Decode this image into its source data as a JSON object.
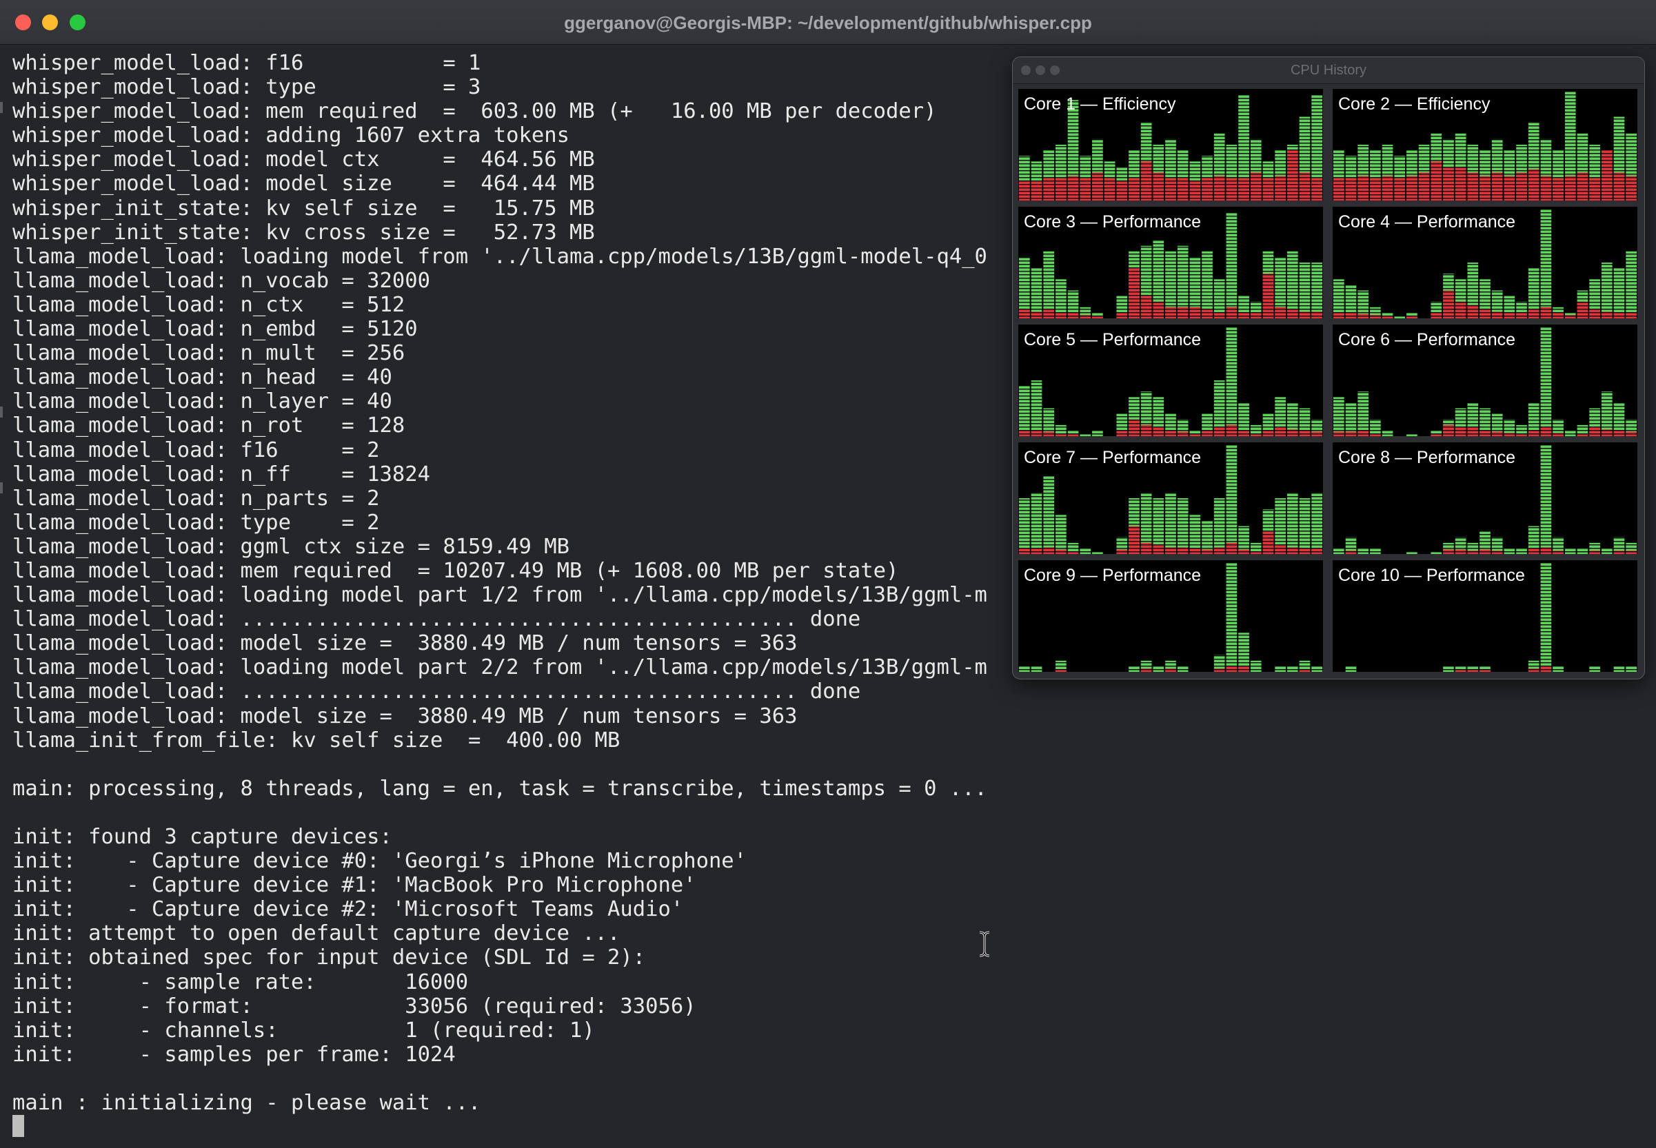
{
  "window": {
    "title": "ggerganov@Georgis-MBP: ~/development/github/whisper.cpp"
  },
  "terminal": {
    "lines": [
      "whisper_model_load: f16           = 1",
      "whisper_model_load: type          = 3",
      "whisper_model_load: mem required  =  603.00 MB (+   16.00 MB per decoder)",
      "whisper_model_load: adding 1607 extra tokens",
      "whisper_model_load: model ctx     =  464.56 MB",
      "whisper_model_load: model size    =  464.44 MB",
      "whisper_init_state: kv self size  =   15.75 MB",
      "whisper_init_state: kv cross size =   52.73 MB",
      "llama_model_load: loading model from '../llama.cpp/models/13B/ggml-model-q4_0",
      "llama_model_load: n_vocab = 32000",
      "llama_model_load: n_ctx   = 512",
      "llama_model_load: n_embd  = 5120",
      "llama_model_load: n_mult  = 256",
      "llama_model_load: n_head  = 40",
      "llama_model_load: n_layer = 40",
      "llama_model_load: n_rot   = 128",
      "llama_model_load: f16     = 2",
      "llama_model_load: n_ff    = 13824",
      "llama_model_load: n_parts = 2",
      "llama_model_load: type    = 2",
      "llama_model_load: ggml ctx size = 8159.49 MB",
      "llama_model_load: mem required  = 10207.49 MB (+ 1608.00 MB per state)",
      "llama_model_load: loading model part 1/2 from '../llama.cpp/models/13B/ggml-m",
      "llama_model_load: ............................................ done",
      "llama_model_load: model size =  3880.49 MB / num tensors = 363",
      "llama_model_load: loading model part 2/2 from '../llama.cpp/models/13B/ggml-m",
      "llama_model_load: ............................................ done",
      "llama_model_load: model size =  3880.49 MB / num tensors = 363",
      "llama_init_from_file: kv self size  =  400.00 MB",
      "",
      "main: processing, 8 threads, lang = en, task = transcribe, timestamps = 0 ...",
      "",
      "init: found 3 capture devices:",
      "init:    - Capture device #0: 'Georgi’s iPhone Microphone'",
      "init:    - Capture device #1: 'MacBook Pro Microphone'",
      "init:    - Capture device #2: 'Microsoft Teams Audio'",
      "init: attempt to open default capture device ...",
      "init: obtained spec for input device (SDL Id = 2):",
      "init:     - sample rate:       16000",
      "init:     - format:            33056 (required: 33056)",
      "init:     - channels:          1 (required: 1)",
      "init:     - samples per frame: 1024",
      "",
      "main : initializing - please wait ..."
    ]
  },
  "cpu_history": {
    "title": "CPU History",
    "colors": {
      "user": "#5fd35a",
      "system": "#e2333a",
      "background": "#000000"
    },
    "cores": [
      {
        "label": "Core 1 — Efficiency",
        "user": [
          0.4,
          0.35,
          0.45,
          0.5,
          0.9,
          0.4,
          0.55,
          0.35,
          0.3,
          0.45,
          0.7,
          0.5,
          0.55,
          0.45,
          0.35,
          0.4,
          0.6,
          0.5,
          0.95,
          0.55,
          0.35,
          0.45,
          0.5,
          0.75,
          0.95
        ],
        "system": [
          0.18,
          0.17,
          0.2,
          0.2,
          0.22,
          0.2,
          0.25,
          0.2,
          0.18,
          0.2,
          0.35,
          0.25,
          0.2,
          0.2,
          0.18,
          0.2,
          0.22,
          0.2,
          0.2,
          0.25,
          0.2,
          0.22,
          0.45,
          0.25,
          0.2
        ]
      },
      {
        "label": "Core 2 — Efficiency",
        "user": [
          0.45,
          0.4,
          0.5,
          0.45,
          0.5,
          0.4,
          0.45,
          0.5,
          0.6,
          0.55,
          0.6,
          0.5,
          0.45,
          0.55,
          0.45,
          0.5,
          0.7,
          0.55,
          0.45,
          0.98,
          0.6,
          0.5,
          0.45,
          0.75,
          0.6
        ],
        "system": [
          0.2,
          0.2,
          0.22,
          0.2,
          0.22,
          0.2,
          0.22,
          0.25,
          0.35,
          0.3,
          0.3,
          0.25,
          0.22,
          0.25,
          0.22,
          0.25,
          0.28,
          0.22,
          0.2,
          0.22,
          0.25,
          0.2,
          0.45,
          0.25,
          0.22
        ]
      },
      {
        "label": "Core 3 — Performance",
        "user": [
          0.55,
          0.45,
          0.6,
          0.35,
          0.25,
          0.1,
          0.05,
          0.0,
          0.2,
          0.6,
          0.65,
          0.7,
          0.6,
          0.65,
          0.55,
          0.6,
          0.35,
          0.95,
          0.2,
          0.15,
          0.6,
          0.55,
          0.6,
          0.5,
          0.5
        ],
        "system": [
          0.08,
          0.06,
          0.08,
          0.05,
          0.05,
          0.03,
          0.02,
          0.0,
          0.05,
          0.45,
          0.2,
          0.15,
          0.1,
          0.1,
          0.1,
          0.08,
          0.05,
          0.1,
          0.05,
          0.05,
          0.4,
          0.1,
          0.08,
          0.06,
          0.06
        ]
      },
      {
        "label": "Core 4 — Performance",
        "user": [
          0.35,
          0.3,
          0.25,
          0.1,
          0.05,
          0.02,
          0.05,
          0.0,
          0.15,
          0.4,
          0.35,
          0.5,
          0.35,
          0.25,
          0.2,
          0.15,
          0.45,
          0.98,
          0.1,
          0.05,
          0.25,
          0.35,
          0.5,
          0.45,
          0.6
        ],
        "system": [
          0.05,
          0.05,
          0.04,
          0.03,
          0.02,
          0.0,
          0.02,
          0.0,
          0.05,
          0.25,
          0.15,
          0.12,
          0.08,
          0.06,
          0.05,
          0.05,
          0.08,
          0.1,
          0.05,
          0.03,
          0.15,
          0.08,
          0.06,
          0.05,
          0.05
        ]
      },
      {
        "label": "Core 5 — Performance",
        "user": [
          0.45,
          0.5,
          0.25,
          0.1,
          0.05,
          0.02,
          0.05,
          0.0,
          0.2,
          0.35,
          0.4,
          0.35,
          0.2,
          0.15,
          0.05,
          0.2,
          0.5,
          0.98,
          0.3,
          0.1,
          0.2,
          0.35,
          0.3,
          0.25,
          0.15
        ],
        "system": [
          0.05,
          0.05,
          0.04,
          0.02,
          0.02,
          0.0,
          0.0,
          0.0,
          0.05,
          0.15,
          0.1,
          0.08,
          0.05,
          0.04,
          0.02,
          0.05,
          0.08,
          0.1,
          0.05,
          0.02,
          0.05,
          0.08,
          0.06,
          0.05,
          0.04
        ]
      },
      {
        "label": "Core 6 — Performance",
        "user": [
          0.35,
          0.3,
          0.4,
          0.15,
          0.05,
          0.0,
          0.02,
          0.0,
          0.05,
          0.15,
          0.25,
          0.3,
          0.25,
          0.2,
          0.15,
          0.1,
          0.3,
          0.98,
          0.15,
          0.05,
          0.1,
          0.25,
          0.4,
          0.3,
          0.15
        ],
        "system": [
          0.04,
          0.04,
          0.05,
          0.02,
          0.0,
          0.0,
          0.0,
          0.0,
          0.02,
          0.1,
          0.08,
          0.08,
          0.05,
          0.04,
          0.03,
          0.02,
          0.05,
          0.08,
          0.03,
          0.0,
          0.02,
          0.08,
          0.06,
          0.05,
          0.04
        ]
      },
      {
        "label": "Core 7 — Performance",
        "user": [
          0.5,
          0.55,
          0.7,
          0.35,
          0.1,
          0.05,
          0.02,
          0.0,
          0.15,
          0.5,
          0.55,
          0.5,
          0.55,
          0.5,
          0.35,
          0.3,
          0.5,
          0.98,
          0.25,
          0.1,
          0.4,
          0.5,
          0.55,
          0.5,
          0.55
        ],
        "system": [
          0.05,
          0.05,
          0.06,
          0.04,
          0.02,
          0.0,
          0.0,
          0.0,
          0.04,
          0.25,
          0.1,
          0.08,
          0.06,
          0.06,
          0.05,
          0.04,
          0.06,
          0.1,
          0.04,
          0.02,
          0.2,
          0.08,
          0.06,
          0.05,
          0.05
        ]
      },
      {
        "label": "Core 8 — Performance",
        "user": [
          0.05,
          0.15,
          0.05,
          0.05,
          0.0,
          0.0,
          0.02,
          0.0,
          0.02,
          0.1,
          0.15,
          0.1,
          0.2,
          0.15,
          0.05,
          0.05,
          0.25,
          0.98,
          0.15,
          0.05,
          0.05,
          0.1,
          0.05,
          0.15,
          0.1
        ],
        "system": [
          0.0,
          0.03,
          0.0,
          0.0,
          0.0,
          0.0,
          0.0,
          0.0,
          0.0,
          0.04,
          0.04,
          0.03,
          0.04,
          0.03,
          0.0,
          0.0,
          0.05,
          0.06,
          0.03,
          0.0,
          0.0,
          0.03,
          0.0,
          0.03,
          0.03
        ]
      },
      {
        "label": "Core 9 — Performance",
        "user": [
          0.05,
          0.05,
          0.0,
          0.1,
          0.0,
          0.0,
          0.0,
          0.0,
          0.0,
          0.05,
          0.1,
          0.05,
          0.1,
          0.05,
          0.0,
          0.0,
          0.15,
          0.98,
          0.35,
          0.1,
          0.0,
          0.05,
          0.05,
          0.1,
          0.05
        ],
        "system": [
          0.0,
          0.0,
          0.0,
          0.02,
          0.0,
          0.0,
          0.0,
          0.0,
          0.0,
          0.0,
          0.03,
          0.0,
          0.03,
          0.0,
          0.0,
          0.0,
          0.03,
          0.05,
          0.05,
          0.0,
          0.0,
          0.0,
          0.0,
          0.02,
          0.0
        ]
      },
      {
        "label": "Core 10 — Performance",
        "user": [
          0.0,
          0.05,
          0.0,
          0.0,
          0.0,
          0.0,
          0.0,
          0.0,
          0.0,
          0.05,
          0.05,
          0.05,
          0.05,
          0.0,
          0.0,
          0.0,
          0.1,
          0.98,
          0.05,
          0.0,
          0.0,
          0.05,
          0.0,
          0.05,
          0.05
        ],
        "system": [
          0.0,
          0.0,
          0.0,
          0.0,
          0.0,
          0.0,
          0.0,
          0.0,
          0.0,
          0.0,
          0.02,
          0.02,
          0.02,
          0.0,
          0.0,
          0.0,
          0.03,
          0.05,
          0.0,
          0.0,
          0.0,
          0.0,
          0.0,
          0.0,
          0.0
        ]
      }
    ]
  }
}
